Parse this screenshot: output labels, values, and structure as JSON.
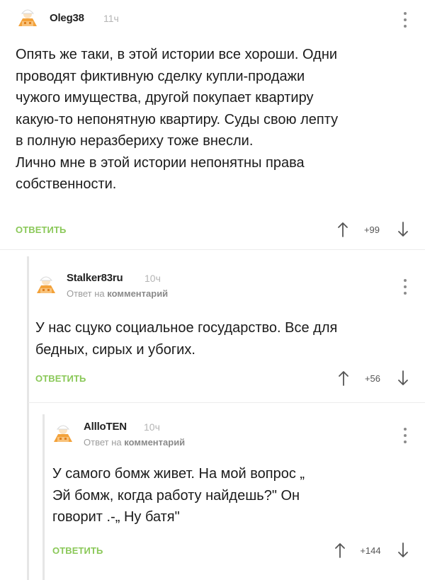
{
  "colors": {
    "reply_green": "#8ac858",
    "rail_gray": "#e6e6e6",
    "avatar_orange": "#f3a23a"
  },
  "comments": [
    {
      "username": "Oleg38",
      "time": "11ч",
      "text": "Опять же таки, в этой истории все хороши. Одни\nпроводят фиктивную сделку купли-продажи\nчужого имущества, другой покупает квартиру\nкакую-то непонятную квартиру. Суды свою лепту\nв полную неразбериху тоже внесли.\nЛично мне в этой истории непонятны права\nсобственности.",
      "reply_label": "ОТВЕТИТЬ",
      "score": "+99",
      "avatar_icon": "default-avatar-icon"
    },
    {
      "username": "Stalker83ru",
      "time": "10ч",
      "reply_prefix": "Ответ на",
      "reply_link": "комментарий",
      "text": "У нас сцуко социальное государство. Все для\nбедных, сирых и убогих.",
      "reply_label": "ОТВЕТИТЬ",
      "score": "+56",
      "avatar_icon": "default-avatar-icon"
    },
    {
      "username": "AllloTEN",
      "time": "10ч",
      "reply_prefix": "Ответ на",
      "reply_link": "комментарий",
      "text": "У самого бомж живет. На мой вопрос „\nЭй бомж, когда работу найдешь?\" Он\nговорит .-„ Ну батя\"",
      "reply_label": "ОТВЕТИТЬ",
      "score": "+144",
      "avatar_icon": "default-avatar-icon"
    }
  ]
}
